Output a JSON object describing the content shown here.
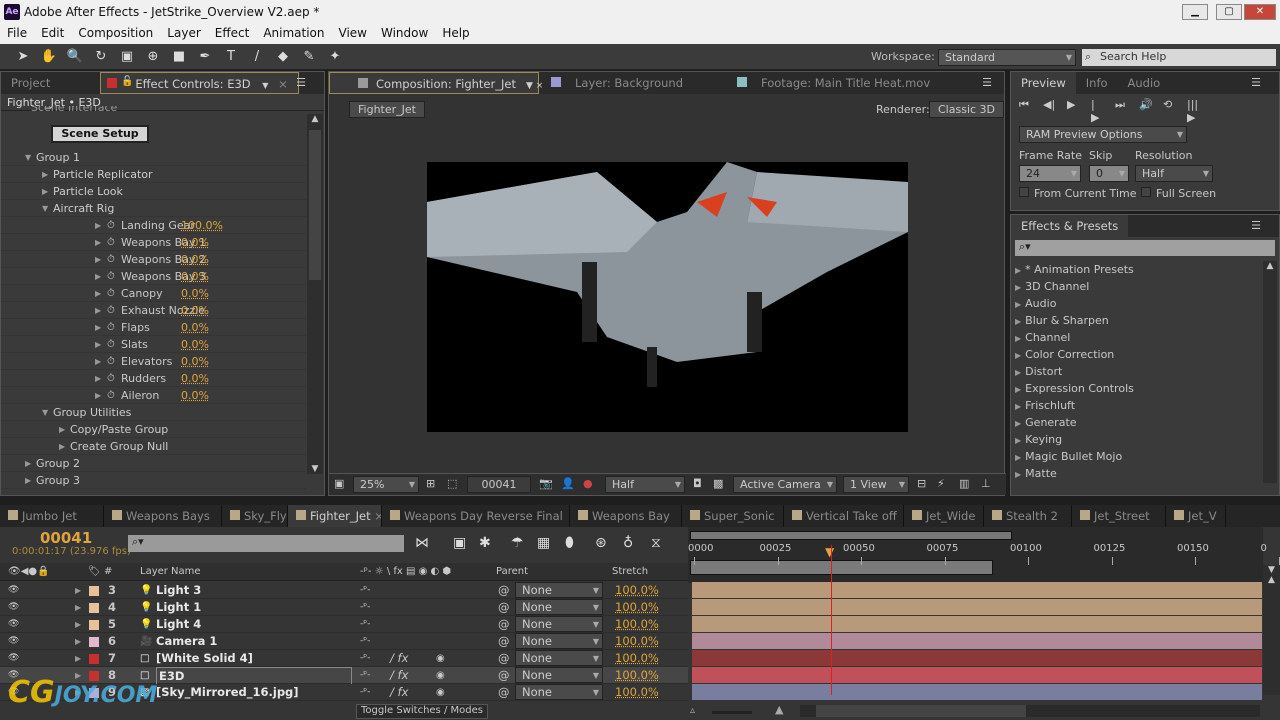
{
  "window": {
    "app_icon": "Ae",
    "title": "Adobe After Effects - JetStrike_Overview V2.aep *",
    "min": "▁",
    "max": "▢",
    "close": "✕"
  },
  "menu": [
    "File",
    "Edit",
    "Composition",
    "Layer",
    "Effect",
    "Animation",
    "View",
    "Window",
    "Help"
  ],
  "toolbar": {
    "tools": [
      "selection-tool",
      "hand-tool",
      "zoom-tool",
      "rotate-tool",
      "camera-tool",
      "pan-behind-tool",
      "rectangle-tool",
      "pen-tool",
      "type-tool",
      "brush-tool",
      "eraser-tool",
      "roto-brush-tool",
      "puppet-tool"
    ],
    "workspace_label": "Workspace:",
    "workspace": "Standard",
    "search_placeholder": "Search Help"
  },
  "left_panel": {
    "tabs": [
      "Project",
      "Effect Controls: E3D"
    ],
    "breadcrumb": "Fighter_Jet • E3D",
    "scene_interface": "Scene Interface",
    "scene_setup": "Scene Setup",
    "tree": [
      {
        "label": "Group 1",
        "level": 0,
        "open": true
      },
      {
        "label": "Particle Replicator",
        "level": 1,
        "open": false
      },
      {
        "label": "Particle Look",
        "level": 1,
        "open": false
      },
      {
        "label": "Aircraft Rig",
        "level": 1,
        "open": true
      },
      {
        "label": "Landing Gear",
        "level": 2,
        "value": "100.0%",
        "stopwatch": true
      },
      {
        "label": "Weapons Bay 1",
        "level": 2,
        "value": "0.0%",
        "stopwatch": true
      },
      {
        "label": "Weapons Bay 2",
        "level": 2,
        "value": "0.0%",
        "stopwatch": true
      },
      {
        "label": "Weapons Bay 3",
        "level": 2,
        "value": "0.0%",
        "stopwatch": true
      },
      {
        "label": "Canopy",
        "level": 2,
        "value": "0.0%",
        "stopwatch": true
      },
      {
        "label": "Exhaust Nozzle",
        "level": 2,
        "value": "0.0%",
        "stopwatch": true
      },
      {
        "label": "Flaps",
        "level": 2,
        "value": "0.0%",
        "stopwatch": true
      },
      {
        "label": "Slats",
        "level": 2,
        "value": "0.0%",
        "stopwatch": true
      },
      {
        "label": "Elevators",
        "level": 2,
        "value": "0.0%",
        "stopwatch": true
      },
      {
        "label": "Rudders",
        "level": 2,
        "value": "0.0%",
        "stopwatch": true
      },
      {
        "label": "Aileron",
        "level": 2,
        "value": "0.0%",
        "stopwatch": true
      },
      {
        "label": "Group Utilities",
        "level": 1,
        "open": true
      },
      {
        "label": "Copy/Paste Group",
        "level": 2,
        "open": false
      },
      {
        "label": "Create Group Null",
        "level": 2,
        "open": false
      },
      {
        "label": "Group 2",
        "level": 0,
        "open": false
      },
      {
        "label": "Group 3",
        "level": 0,
        "open": false
      }
    ]
  },
  "viewer": {
    "tabs": [
      "Composition: Fighter_Jet",
      "Layer: Background",
      "Footage: Main Title Heat.mov"
    ],
    "comp_name": "Fighter_Jet",
    "renderer_label": "Renderer:",
    "renderer": "Classic 3D",
    "footer": {
      "zoom": "25%",
      "timecode": "00041",
      "resolution": "Half",
      "camera": "Active Camera",
      "views": "1 View"
    }
  },
  "preview": {
    "tabs": [
      "Preview",
      "Info",
      "Audio"
    ],
    "ram_options": "RAM Preview Options",
    "frame_rate_label": "Frame Rate",
    "frame_rate": "24",
    "skip_label": "Skip",
    "skip": "0",
    "resolution_label": "Resolution",
    "resolution": "Half",
    "from_current": "From Current Time",
    "full_screen": "Full Screen"
  },
  "effects_presets": {
    "title": "Effects & Presets",
    "items": [
      "* Animation Presets",
      "3D Channel",
      "Audio",
      "Blur & Sharpen",
      "Channel",
      "Color Correction",
      "Distort",
      "Expression Controls",
      "Frischluft",
      "Generate",
      "Keying",
      "Magic Bullet Mojo",
      "Matte"
    ]
  },
  "timeline": {
    "tabs": [
      "Jumbo Jet",
      "Weapons Bays",
      "Sky_Fly",
      "Fighter_Jet",
      "Weapons Day Reverse Final",
      "Weapons Bay",
      "Super_Sonic",
      "Vertical Take off",
      "Jet_Wide",
      "Stealth 2",
      "Jet_Street",
      "Jet_V"
    ],
    "active_tab": "Fighter_Jet",
    "current_frame": "00041",
    "current_time": "0:00:01:17 (23.976 fps)",
    "headers": {
      "layer_name": "Layer Name",
      "parent": "Parent",
      "stretch": "Stretch",
      "num": "#"
    },
    "ruler": [
      "0000",
      "00025",
      "00050",
      "00075",
      "00100",
      "00125",
      "00150",
      "0"
    ],
    "playhead_frame": 41,
    "layers": [
      {
        "num": "3",
        "name": "Light 3",
        "type": "light",
        "label_color": "#e8c09a",
        "bar_color": "#b8997a",
        "parent": "None",
        "stretch": "100.0%"
      },
      {
        "num": "4",
        "name": "Light 1",
        "type": "light",
        "label_color": "#e8c09a",
        "bar_color": "#b8997a",
        "parent": "None",
        "stretch": "100.0%"
      },
      {
        "num": "5",
        "name": "Light 4",
        "type": "light",
        "label_color": "#e8c09a",
        "bar_color": "#b8997a",
        "parent": "None",
        "stretch": "100.0%"
      },
      {
        "num": "6",
        "name": "Camera 1",
        "type": "camera",
        "label_color": "#e4b8cc",
        "bar_color": "#b08a98",
        "parent": "None",
        "stretch": "100.0%"
      },
      {
        "num": "7",
        "name": "[White Solid 4]",
        "type": "solid",
        "label_color": "#c83030",
        "bar_color": "#8a3838",
        "parent": "None",
        "stretch": "100.0%"
      },
      {
        "num": "8",
        "name": "E3D",
        "type": "solid",
        "label_color": "#c83030",
        "bar_color": "#c0505a",
        "parent": "None",
        "stretch": "100.0%",
        "selected": true
      },
      {
        "num": "9",
        "name": "[Sky_Mirrored_16.jpg]",
        "type": "footage",
        "label_color": "#aab0d8",
        "bar_color": "#7a7e9e",
        "parent": "None",
        "stretch": "100.0%"
      }
    ],
    "toggle_label": "Toggle Switches / Modes"
  },
  "watermark": "CGJOY.COM"
}
